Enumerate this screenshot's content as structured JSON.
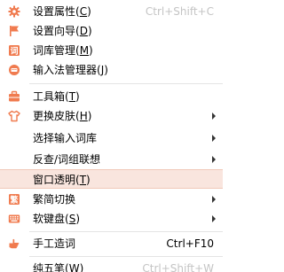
{
  "accent_color": "#f07b4f",
  "hover_color": "#f9e5de",
  "menu": {
    "items": [
      {
        "label": "设置属性(",
        "accel": "C",
        "close": ")",
        "shortcut": "Ctrl+Shift+C",
        "shortcut_disabled": true,
        "icon": "gear-icon"
      },
      {
        "label": "设置向导(",
        "accel": "D",
        "close": ")",
        "shortcut": "",
        "icon": "flag-icon"
      },
      {
        "label": "词库管理(",
        "accel": "M",
        "close": ")",
        "shortcut": "",
        "icon": "dictionary-icon"
      },
      {
        "label": "输入法管理器(",
        "accel": "J",
        "close": ")",
        "shortcut": "",
        "icon": "keyboard-manager-icon"
      },
      {
        "label": "工具箱(",
        "accel": "T",
        "close": ")",
        "shortcut": "",
        "icon": "toolbox-icon"
      },
      {
        "label": "更换皮肤(",
        "accel": "H",
        "close": ")",
        "shortcut": "",
        "icon": "shirt-icon",
        "submenu": true
      },
      {
        "label": "选择输入词库",
        "accel": "",
        "close": "",
        "shortcut": "",
        "icon": "",
        "submenu": true
      },
      {
        "label": "反查/词组联想",
        "accel": "",
        "close": "",
        "shortcut": "",
        "icon": "",
        "submenu": true
      },
      {
        "label": "窗口透明(",
        "accel": "T",
        "close": ")",
        "shortcut": "",
        "icon": ""
      },
      {
        "label": "繁简切换",
        "accel": "",
        "close": "",
        "shortcut": "",
        "icon": "traditional-simplified-icon",
        "submenu": true
      },
      {
        "label": "软键盘(",
        "accel": "S",
        "close": ")",
        "shortcut": "",
        "icon": "soft-keyboard-icon",
        "submenu": true
      },
      {
        "label": "手工造词",
        "accel": "",
        "close": "",
        "shortcut": "Ctrl+F10",
        "icon": "hand-icon"
      },
      {
        "label": "纯五笔(",
        "accel": "W",
        "close": ")",
        "shortcut": "Ctrl+Shift+W",
        "shortcut_disabled": true,
        "icon": ""
      }
    ]
  }
}
